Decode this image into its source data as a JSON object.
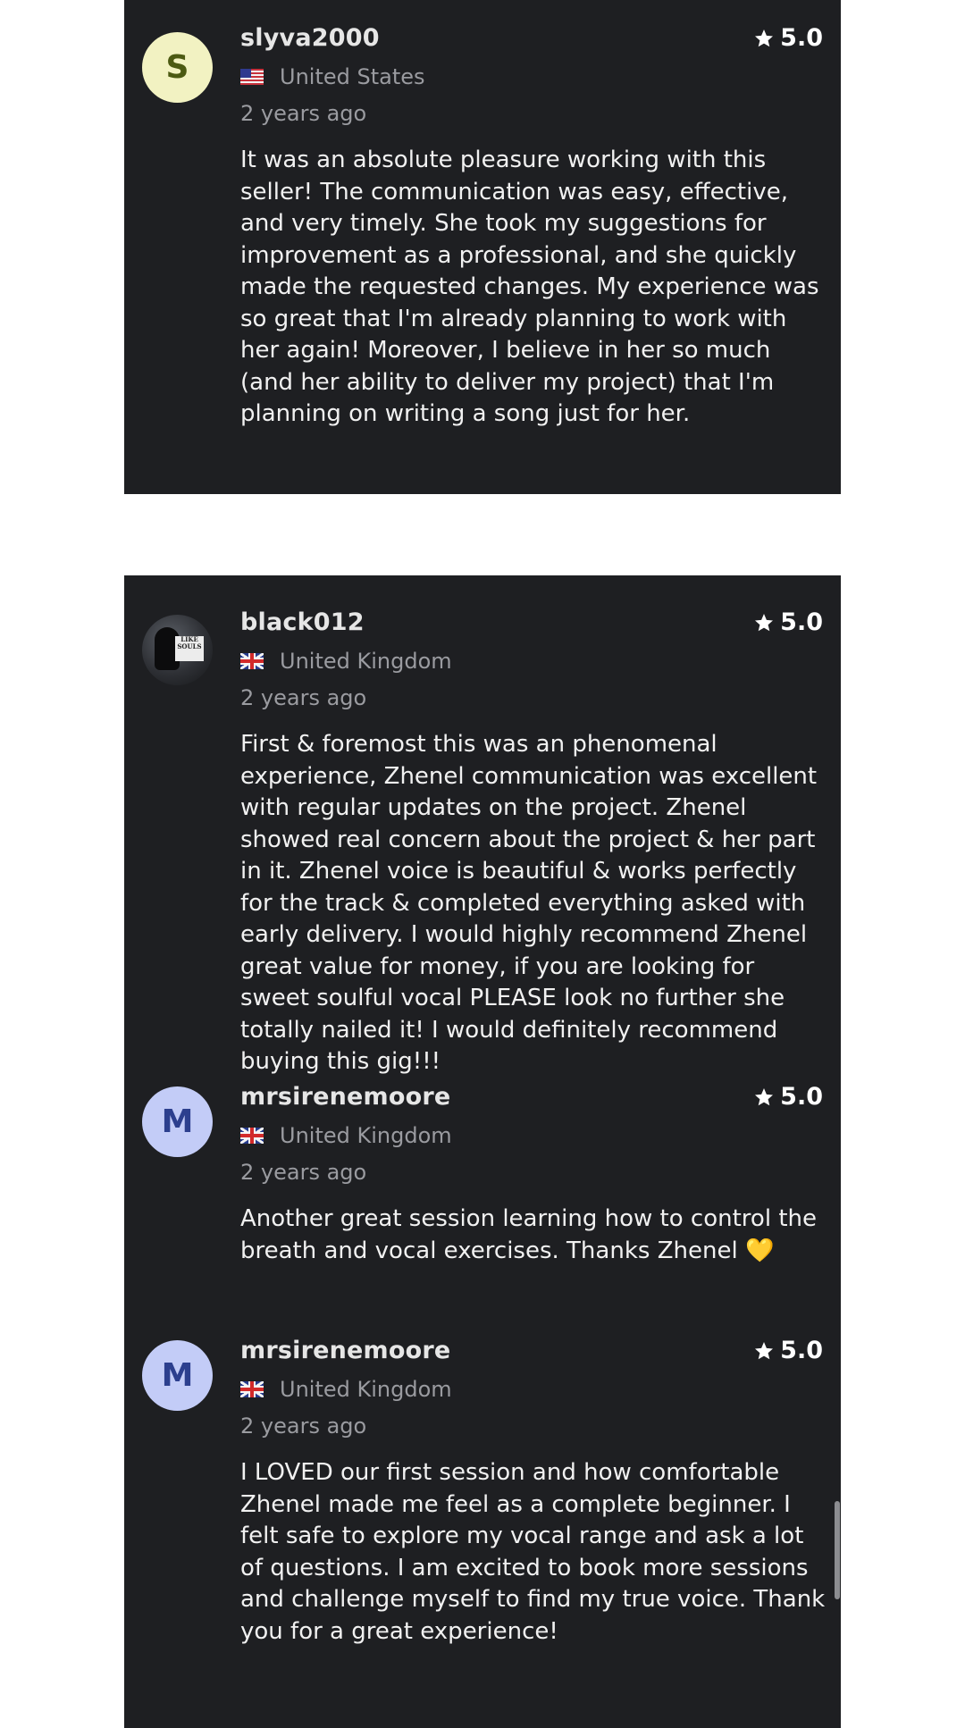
{
  "reviews": [
    {
      "username": "slyva2000",
      "avatar_letter": "S",
      "avatar_style": "yellow",
      "country": "United States",
      "flag": "us-flag-icon",
      "time": "2 years ago",
      "rating": "5.0",
      "text": "It was an absolute pleasure working with this seller! The communication was easy, effective, and very timely. She took my suggestions for improvement as a professional, and she quickly made the requested changes. My experience was so great that I'm already planning to work with her again! Moreover, I believe in her so much (and her ability to deliver my project) that I'm planning on writing a song just for her."
    },
    {
      "username": "black012",
      "avatar_letter": "",
      "avatar_style": "photo",
      "avatar_badge_text": "LIKE SOULS",
      "country": "United Kingdom",
      "flag": "uk-flag-icon",
      "time": "2 years ago",
      "rating": "5.0",
      "text": "First & foremost this was an phenomenal experience, Zhenel communication was excellent with regular updates on the project. Zhenel showed real concern about the project & her part in it. Zhenel voice is beautiful & works perfectly for the track & completed everything asked with early delivery. I would highly recommend Zhenel great value for money, if you are looking for sweet soulful vocal PLEASE look no further she totally nailed it! I would definitely recommend buying this gig!!!"
    },
    {
      "username": "mrsirenemoore",
      "avatar_letter": "M",
      "avatar_style": "blue",
      "country": "United Kingdom",
      "flag": "uk-flag-icon",
      "time": "2 years ago",
      "rating": "5.0",
      "text": "Another great session learning how to control the breath and vocal exercises. Thanks Zhenel 💛"
    },
    {
      "username": "mrsirenemoore",
      "avatar_letter": "M",
      "avatar_style": "blue",
      "country": "United Kingdom",
      "flag": "uk-flag-icon",
      "time": "2 years ago",
      "rating": "5.0",
      "text": "I LOVED our first session and how comfortable Zhenel made me feel as a complete beginner. I felt safe to explore my vocal range and ask a lot of questions. I am excited to book more sessions and challenge myself to find my true voice. Thank you for a great experience!"
    }
  ],
  "colors": {
    "card_background": "#1e1f22",
    "page_background": "#ffffff",
    "secondary_text": "#9a9ba0"
  }
}
